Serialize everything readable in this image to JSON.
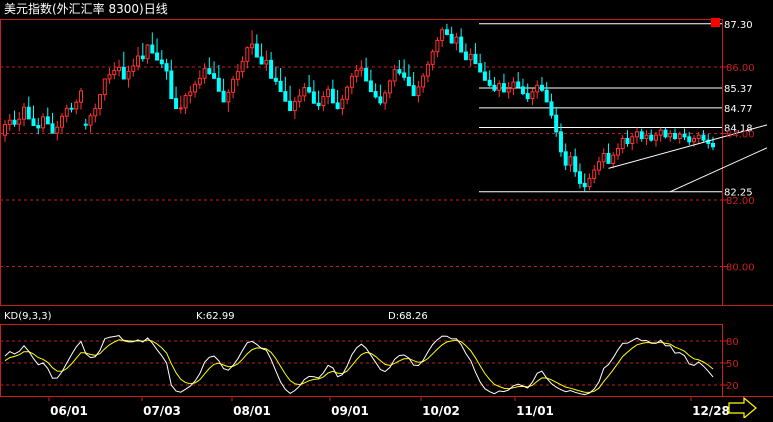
{
  "chart_data": [
    {
      "type": "candlestick",
      "title": "美元指数(外汇汇率 8300)日线",
      "y_ticks": [
        "86.00",
        "84.00",
        "82.00",
        "80.00"
      ],
      "ylim": [
        78.0,
        87.6
      ],
      "x_ticks": [
        "06/01",
        "07/03",
        "08/01",
        "09/01",
        "10/02",
        "11/01",
        "12/28"
      ],
      "price_level_lines": [
        {
          "value": 87.3,
          "label": "87.30"
        },
        {
          "value": 85.37,
          "label": "85.37"
        },
        {
          "value": 84.77,
          "label": "84.77"
        },
        {
          "value": 84.18,
          "label": "84.18"
        },
        {
          "value": 82.25,
          "label": "82.25"
        }
      ],
      "trend_channel": {
        "lower": [
          [
            140,
            82.25
          ],
          [
            157,
            83.27
          ]
        ],
        "upper": [
          [
            127,
            82.95
          ],
          [
            157,
            83.96
          ]
        ]
      },
      "up_color": "#ff3232",
      "down_color": "#00ffff",
      "candles": [
        [
          83.95,
          84.41,
          83.75,
          84.27
        ],
        [
          84.27,
          84.59,
          84.08,
          84.4
        ],
        [
          84.4,
          84.69,
          84.2,
          84.28
        ],
        [
          84.28,
          84.65,
          84.06,
          84.43
        ],
        [
          84.43,
          84.92,
          84.22,
          84.79
        ],
        [
          84.79,
          85.11,
          84.57,
          84.44
        ],
        [
          84.44,
          84.84,
          84.28,
          84.24
        ],
        [
          84.24,
          84.47,
          83.98,
          84.17
        ],
        [
          84.17,
          84.61,
          84.04,
          84.5
        ],
        [
          84.5,
          84.78,
          84.35,
          84.29
        ],
        [
          84.29,
          84.62,
          84.16,
          84.01
        ],
        [
          84.01,
          84.38,
          83.79,
          84.19
        ],
        [
          84.19,
          84.61,
          84.02,
          84.52
        ],
        [
          84.52,
          84.87,
          84.33,
          84.76
        ],
        [
          84.76,
          84.92,
          84.63,
          84.74
        ],
        [
          84.74,
          85.02,
          84.58,
          84.94
        ],
        [
          84.94,
          85.37,
          84.72,
          85.28
        ],
        [
          84.28,
          84.44,
          84.12,
          84.25
        ],
        [
          84.25,
          84.61,
          84.03,
          84.53
        ],
        [
          84.53,
          84.9,
          84.33,
          84.75
        ],
        [
          84.75,
          85.03,
          84.54,
          85.17
        ],
        [
          85.17,
          85.44,
          84.99,
          85.64
        ],
        [
          85.64,
          85.97,
          85.5,
          85.77
        ],
        [
          85.77,
          86.14,
          85.63,
          85.89
        ],
        [
          85.89,
          86.22,
          85.72,
          85.99
        ],
        [
          85.99,
          86.46,
          85.77,
          85.64
        ],
        [
          85.64,
          86.04,
          85.38,
          85.87
        ],
        [
          85.87,
          86.25,
          85.71,
          86.03
        ],
        [
          86.03,
          86.61,
          85.9,
          86.33
        ],
        [
          86.33,
          86.72,
          86.16,
          86.25
        ],
        [
          86.25,
          86.69,
          86.1,
          86.66
        ],
        [
          86.66,
          87.04,
          86.45,
          86.42
        ],
        [
          86.42,
          86.86,
          86.25,
          86.21
        ],
        [
          86.21,
          86.51,
          85.97,
          86.1
        ],
        [
          86.1,
          86.25,
          85.62,
          85.88
        ],
        [
          85.88,
          86.22,
          85.73,
          85.05
        ],
        [
          85.05,
          85.41,
          84.85,
          84.75
        ],
        [
          84.75,
          85.14,
          84.6,
          84.77
        ],
        [
          84.77,
          85.21,
          84.59,
          85.14
        ],
        [
          85.14,
          85.43,
          84.91,
          85.25
        ],
        [
          85.25,
          85.59,
          85.08,
          85.48
        ],
        [
          85.48,
          85.9,
          85.34,
          85.66
        ],
        [
          85.66,
          86.11,
          85.5,
          85.95
        ],
        [
          85.95,
          86.29,
          85.76,
          85.8
        ],
        [
          85.8,
          86.17,
          85.63,
          85.66
        ],
        [
          85.66,
          86.06,
          85.47,
          85.27
        ],
        [
          85.27,
          85.65,
          85.08,
          84.95
        ],
        [
          84.95,
          85.33,
          84.65,
          85.24
        ],
        [
          85.24,
          85.73,
          85.06,
          85.63
        ],
        [
          85.63,
          86.09,
          85.43,
          85.86
        ],
        [
          85.86,
          86.32,
          85.68,
          86.17
        ],
        [
          86.17,
          86.62,
          85.96,
          86.58
        ],
        [
          86.58,
          87.11,
          86.37,
          86.69
        ],
        [
          86.69,
          86.98,
          86.49,
          86.3
        ],
        [
          86.3,
          86.71,
          86.12,
          86.09
        ],
        [
          86.09,
          86.5,
          85.88,
          86.2
        ],
        [
          86.2,
          86.45,
          85.95,
          85.66
        ],
        [
          85.66,
          86.01,
          85.46,
          85.57
        ],
        [
          85.57,
          85.97,
          85.37,
          85.26
        ],
        [
          85.26,
          85.71,
          85.09,
          84.97
        ],
        [
          84.97,
          85.44,
          84.75,
          84.69
        ],
        [
          84.69,
          85.09,
          84.44,
          84.96
        ],
        [
          84.96,
          85.34,
          84.78,
          85.13
        ],
        [
          85.13,
          85.52,
          84.96,
          85.38
        ],
        [
          85.38,
          85.76,
          85.2,
          85.25
        ],
        [
          85.25,
          85.6,
          85.08,
          84.91
        ],
        [
          84.91,
          85.29,
          84.71,
          84.84
        ],
        [
          84.84,
          85.27,
          84.67,
          85.11
        ],
        [
          85.11,
          85.44,
          84.88,
          85.33
        ],
        [
          85.33,
          85.62,
          85.11,
          84.92
        ],
        [
          84.92,
          85.31,
          84.72,
          84.75
        ],
        [
          84.75,
          85.16,
          84.55,
          85.03
        ],
        [
          85.03,
          85.45,
          84.88,
          85.39
        ],
        [
          85.39,
          85.82,
          85.18,
          85.72
        ],
        [
          85.72,
          86.06,
          85.53,
          85.9
        ],
        [
          85.9,
          86.2,
          85.71,
          85.96
        ],
        [
          85.96,
          86.28,
          85.78,
          85.58
        ],
        [
          85.58,
          85.92,
          85.36,
          85.26
        ],
        [
          85.26,
          85.51,
          85.05,
          85.1
        ],
        [
          85.1,
          85.47,
          84.85,
          84.92
        ],
        [
          84.92,
          85.3,
          84.71,
          85.22
        ],
        [
          85.22,
          85.63,
          85.06,
          85.58
        ],
        [
          85.58,
          86.07,
          85.42,
          85.92
        ],
        [
          85.92,
          86.21,
          85.75,
          85.82
        ],
        [
          85.82,
          86.23,
          85.59,
          85.69
        ],
        [
          85.69,
          86.08,
          85.45,
          85.44
        ],
        [
          85.44,
          85.85,
          85.22,
          85.14
        ],
        [
          85.14,
          85.58,
          84.94,
          85.4
        ],
        [
          85.4,
          85.82,
          85.23,
          85.73
        ],
        [
          85.73,
          86.18,
          85.54,
          86.08
        ],
        [
          86.08,
          86.53,
          85.9,
          86.46
        ],
        [
          86.46,
          86.9,
          86.3,
          86.8
        ],
        [
          86.8,
          87.2,
          86.6,
          87.12
        ],
        [
          87.12,
          87.3,
          86.95,
          86.98
        ],
        [
          86.98,
          87.21,
          86.78,
          86.72
        ],
        [
          86.72,
          87.03,
          86.5,
          86.9
        ],
        [
          86.9,
          87.16,
          86.71,
          86.45
        ],
        [
          86.45,
          86.71,
          86.21,
          86.22
        ],
        [
          86.22,
          86.56,
          86.02,
          86.38
        ],
        [
          86.38,
          86.72,
          86.18,
          86.1
        ],
        [
          86.1,
          86.4,
          85.9,
          85.85
        ],
        [
          85.85,
          86.15,
          85.65,
          85.6
        ],
        [
          85.6,
          85.9,
          85.4,
          85.45
        ],
        [
          85.45,
          85.7,
          85.25,
          85.3
        ],
        [
          85.3,
          85.6,
          85.1,
          85.5
        ],
        [
          85.5,
          85.8,
          85.3,
          85.25
        ],
        [
          85.25,
          85.55,
          85.05,
          85.35
        ],
        [
          85.35,
          85.7,
          85.15,
          85.55
        ],
        [
          85.55,
          85.85,
          85.35,
          85.4
        ],
        [
          85.4,
          85.65,
          85.15,
          85.2
        ],
        [
          85.2,
          85.5,
          84.95,
          85.05
        ],
        [
          85.05,
          85.35,
          84.85,
          85.25
        ],
        [
          85.25,
          85.6,
          85.05,
          85.45
        ],
        [
          85.45,
          85.7,
          85.25,
          85.3
        ],
        [
          85.3,
          85.55,
          85.05,
          84.95
        ],
        [
          84.95,
          85.2,
          84.45,
          84.55
        ],
        [
          84.55,
          84.8,
          83.9,
          84.05
        ],
        [
          84.05,
          84.3,
          83.3,
          83.45
        ],
        [
          83.45,
          83.7,
          82.9,
          83.05
        ],
        [
          83.05,
          83.45,
          82.85,
          83.3
        ],
        [
          83.3,
          83.55,
          82.7,
          82.85
        ],
        [
          82.85,
          83.1,
          82.35,
          82.5
        ],
        [
          82.5,
          82.8,
          82.25,
          82.4
        ],
        [
          82.4,
          82.8,
          82.3,
          82.65
        ],
        [
          82.65,
          83.05,
          82.5,
          82.9
        ],
        [
          82.9,
          83.3,
          82.75,
          83.15
        ],
        [
          83.15,
          83.55,
          82.95,
          83.4
        ],
        [
          83.4,
          83.7,
          83.2,
          83.1
        ],
        [
          83.1,
          83.45,
          82.95,
          83.35
        ],
        [
          83.35,
          83.7,
          83.2,
          83.55
        ],
        [
          83.55,
          83.95,
          83.4,
          83.85
        ],
        [
          83.85,
          84.1,
          83.6,
          83.7
        ],
        [
          83.7,
          84.0,
          83.5,
          83.9
        ],
        [
          83.9,
          84.18,
          83.7,
          84.05
        ],
        [
          84.05,
          84.15,
          83.75,
          83.85
        ],
        [
          83.85,
          84.1,
          83.65,
          83.95
        ],
        [
          83.95,
          84.12,
          83.75,
          83.8
        ],
        [
          83.8,
          84.05,
          83.6,
          83.95
        ],
        [
          83.95,
          84.18,
          83.75,
          84.1
        ],
        [
          84.1,
          84.18,
          83.85,
          83.9
        ],
        [
          83.9,
          84.1,
          83.75,
          84.0
        ],
        [
          84.0,
          84.15,
          83.8,
          83.85
        ],
        [
          83.85,
          84.05,
          83.7,
          83.98
        ],
        [
          83.98,
          84.15,
          83.8,
          83.9
        ],
        [
          83.9,
          84.05,
          83.65,
          83.75
        ],
        [
          83.75,
          83.95,
          83.6,
          83.85
        ],
        [
          83.85,
          84.05,
          83.7,
          83.95
        ],
        [
          83.95,
          84.1,
          83.75,
          83.8
        ],
        [
          83.8,
          83.98,
          83.55,
          83.7
        ],
        [
          83.7,
          83.9,
          83.5,
          83.6
        ]
      ]
    },
    {
      "type": "line",
      "title": "KD(9,3,3)",
      "k_label": "K:62.99",
      "d_label": "D:68.26",
      "y_ticks": [
        "80",
        "50",
        "20"
      ],
      "ylim": [
        0,
        100
      ],
      "series": [
        {
          "name": "K",
          "color": "#ffffff"
        },
        {
          "name": "D",
          "color": "#ffff00"
        }
      ]
    }
  ],
  "nav_arrow_icon": "right-arrow-icon"
}
